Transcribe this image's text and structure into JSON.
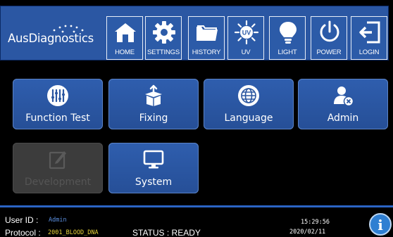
{
  "header": {
    "logo_text": "AusDiagnostics",
    "buttons": [
      {
        "label": "HOME",
        "icon": "home-icon"
      },
      {
        "label": "SETTINGS",
        "icon": "gear-icon"
      },
      {
        "label": "HISTORY",
        "icon": "folder-icon"
      },
      {
        "label": "UV",
        "icon": "uv-icon",
        "badge": "UV"
      },
      {
        "label": "LIGHT",
        "icon": "lightbulb-icon"
      },
      {
        "label": "POWER",
        "icon": "power-icon"
      },
      {
        "label": "LOGIN",
        "icon": "login-icon"
      }
    ]
  },
  "tiles": [
    {
      "label": "Function Test",
      "icon": "sliders-icon",
      "enabled": true
    },
    {
      "label": "Fixing",
      "icon": "box-icon",
      "enabled": true
    },
    {
      "label": "Language",
      "icon": "globe-icon",
      "enabled": true
    },
    {
      "label": "Admin",
      "icon": "admin-user-icon",
      "enabled": true
    },
    {
      "label": "Development",
      "icon": "edit-icon",
      "enabled": false
    },
    {
      "label": "System",
      "icon": "monitor-icon",
      "enabled": true
    }
  ],
  "status": {
    "user_label": "User ID :",
    "user_value": "Admin",
    "protocol_label": "Protocol :",
    "protocol_value": "2001_BLOOD_DNA",
    "status_text": "STATUS : READY",
    "time": "15:29:56",
    "date": "2020/02/11",
    "info_glyph": "i"
  },
  "colors": {
    "header_bg": "#2b57a3",
    "tile_bg": "#2a56a0",
    "status_accent": "#2b64c4",
    "protocol_value": "#e6d23a",
    "user_value": "#5b8fe0"
  }
}
